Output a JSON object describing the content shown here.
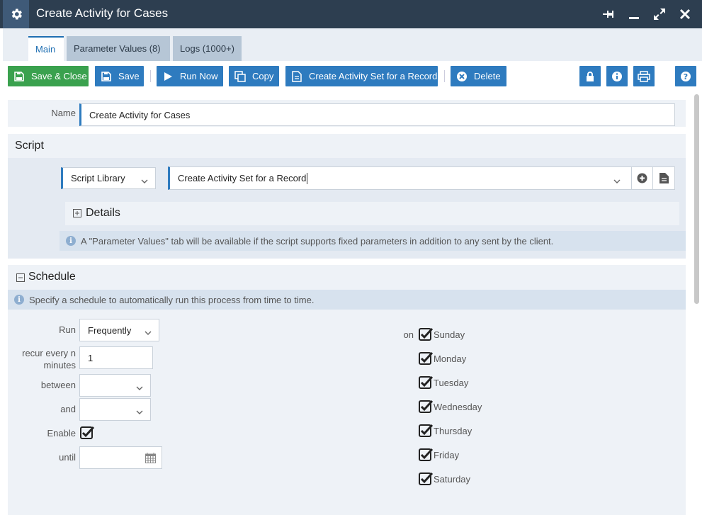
{
  "window": {
    "title": "Create Activity for Cases"
  },
  "tabs": [
    {
      "label": "Main"
    },
    {
      "label": "Parameter Values (8)"
    },
    {
      "label": "Logs (1000+)"
    }
  ],
  "toolbar": {
    "save_close": "Save & Close",
    "save": "Save",
    "run_now": "Run Now",
    "copy": "Copy",
    "create_activity_set": "Create Activity Set for a Record",
    "delete": "Delete"
  },
  "name_field": {
    "label": "Name",
    "value": "Create Activity for Cases"
  },
  "script": {
    "title": "Script",
    "source": "Script Library",
    "selected": "Create Activity Set for a Record",
    "details_label": "Details",
    "info": "A \"Parameter Values\" tab will be available if the script supports fixed parameters in addition to any sent by the client."
  },
  "schedule": {
    "title": "Schedule",
    "info": "Specify a schedule to automatically run this process from time to time.",
    "run_label": "Run",
    "run_value": "Frequently",
    "recur_label_1": "recur every n",
    "recur_label_2": "minutes",
    "recur_value": "1",
    "between_label": "between",
    "and_label": "and",
    "enable_label": "Enable",
    "enabled": true,
    "until_label": "until",
    "on_label": "on",
    "days": [
      {
        "label": "Sunday",
        "checked": true
      },
      {
        "label": "Monday",
        "checked": true
      },
      {
        "label": "Tuesday",
        "checked": true
      },
      {
        "label": "Wednesday",
        "checked": true
      },
      {
        "label": "Thursday",
        "checked": true
      },
      {
        "label": "Friday",
        "checked": true
      },
      {
        "label": "Saturday",
        "checked": true
      }
    ]
  },
  "colors": {
    "titlebar": "#2d3e50",
    "accent_blue": "#2e7bbf",
    "green": "#3aa14e",
    "panel_bg": "#eef2f7",
    "info_bg": "#d7e2ee"
  }
}
